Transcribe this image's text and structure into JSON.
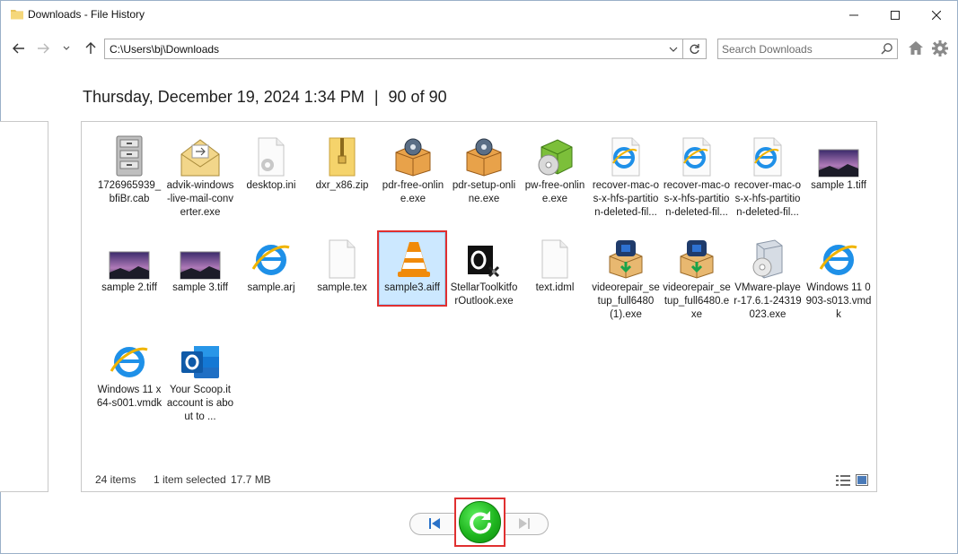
{
  "window": {
    "title": "Downloads - File History"
  },
  "address": {
    "path": "C:\\Users\\bj\\Downloads"
  },
  "search": {
    "placeholder": "Search Downloads"
  },
  "header": {
    "date": "Thursday, December 19, 2024 1:34 PM",
    "separator": "|",
    "position": "90 of 90"
  },
  "files": [
    {
      "name": "1726965939_bfiBr.cab",
      "icon": "cabinet-icon"
    },
    {
      "name": "advik-windows-live-mail-converter.exe",
      "icon": "envelope-icon"
    },
    {
      "name": "desktop.ini",
      "icon": "settings-file-icon"
    },
    {
      "name": "dxr_x86.zip",
      "icon": "zip-folder-icon"
    },
    {
      "name": "pdr-free-online.exe",
      "icon": "installer-box-icon"
    },
    {
      "name": "pdr-setup-online.exe",
      "icon": "installer-box-icon"
    },
    {
      "name": "pw-free-online.exe",
      "icon": "software-box-icon"
    },
    {
      "name": "recover-mac-os-x-hfs-partition-deleted-fil...",
      "icon": "internet-explorer-file-icon"
    },
    {
      "name": "recover-mac-os-x-hfs-partition-deleted-fil...",
      "icon": "internet-explorer-file-icon"
    },
    {
      "name": "recover-mac-os-x-hfs-partition-deleted-fil...",
      "icon": "internet-explorer-file-icon"
    },
    {
      "name": "sample 1.tiff",
      "icon": "image-thumbnail-icon"
    },
    {
      "name": "sample 2.tiff",
      "icon": "image-thumbnail-icon"
    },
    {
      "name": "sample 3.tiff",
      "icon": "image-thumbnail-icon"
    },
    {
      "name": "sample.arj",
      "icon": "internet-explorer-icon"
    },
    {
      "name": "sample.tex",
      "icon": "blank-file-icon"
    },
    {
      "name": "sample3.aiff",
      "icon": "vlc-cone-icon"
    },
    {
      "name": "StellarToolkitforOutlook.exe",
      "icon": "stellar-outlook-icon"
    },
    {
      "name": "text.idml",
      "icon": "blank-file-icon"
    },
    {
      "name": "videorepair_setup_full6480 (1).exe",
      "icon": "video-repair-installer-icon"
    },
    {
      "name": "videorepair_setup_full6480.exe",
      "icon": "video-repair-installer-icon"
    },
    {
      "name": "VMware-player-17.6.1-24319023.exe",
      "icon": "vmware-installer-icon"
    },
    {
      "name": "Windows 11 0903-s013.vmdk",
      "icon": "internet-explorer-icon"
    },
    {
      "name": "Windows 11 x64-s001.vmdk",
      "icon": "internet-explorer-icon"
    },
    {
      "name": "Your Scoop.it account is about to ...",
      "icon": "outlook-icon"
    }
  ],
  "labels": {
    "f0": "1726965939_bfiBr.cab",
    "f1": "advik-windows-live-mail-converter.exe",
    "f2": "desktop.ini",
    "f3": "dxr_x86.zip",
    "f4": "pdr-free-online.exe",
    "f5": "pdr-setup-online.exe",
    "f6": "pw-free-online.exe",
    "f7": "recover-mac-os-x-hfs-partition-deleted-fil...",
    "f8": "recover-mac-os-x-hfs-partition-deleted-fil...",
    "f9": "recover-mac-os-x-hfs-partition-deleted-fil...",
    "f10": "sample 1.tiff",
    "f11": "sample 2.tiff",
    "f12": "sample 3.tiff",
    "f13": "sample.arj",
    "f14": "sample.tex",
    "f15": "sample3.aiff",
    "f16": "StellarToolkitforOutlook.exe",
    "f17": "text.idml",
    "f18": "videorepair_setup_full6480 (1).exe",
    "f19": "videorepair_setup_full6480.exe",
    "f20": "VMware-player-17.6.1-24319023.exe",
    "f21": "Windows 11 0903-s013.vmdk",
    "f22": "Windows 11 x64-s001.vmdk",
    "f23": "Your Scoop.it account is about to ..."
  },
  "status": {
    "count": "24 items",
    "selected": "1 item selected",
    "size": "17.7 MB"
  },
  "colors": {
    "highlight_border": "#e03030",
    "selection_fill": "#cce8ff",
    "restore_green": "#1fb51f"
  }
}
